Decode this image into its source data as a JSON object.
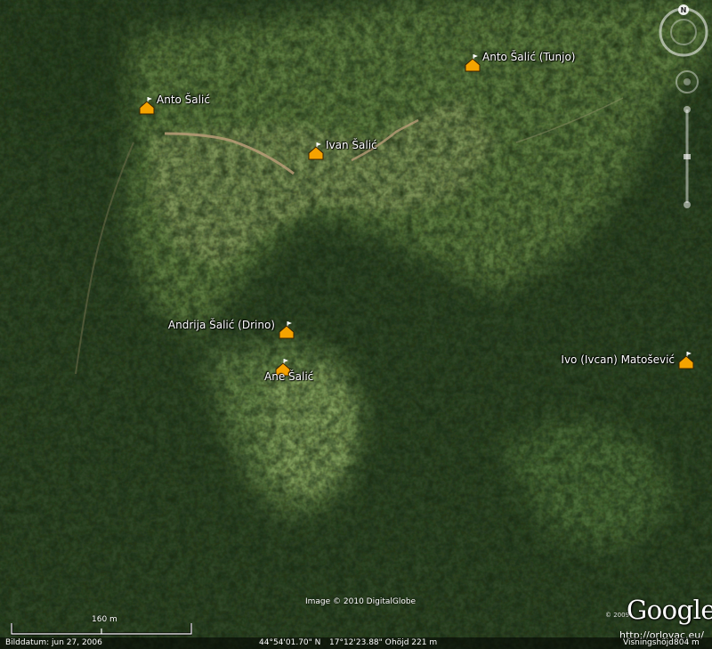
{
  "placemarks": [
    {
      "id": "anto-salic",
      "label": "Anto Šalić"
    },
    {
      "id": "anto-salic-tunjo",
      "label": "Anto Šalić (Tunjo)"
    },
    {
      "id": "ivan-salic",
      "label": "Ivan Šalić"
    },
    {
      "id": "andrija-salic-drino",
      "label": "Andrija Šalić (Drino)"
    },
    {
      "id": "ane-salic",
      "label": "Ane Šalić"
    },
    {
      "id": "ivo-ivcan-matosevic",
      "label": "Ivo (Ivcan) Matošević"
    }
  ],
  "imagery_credit": "Image © 2010 DigitalGlobe",
  "copyright_year": "© 2009",
  "brand": "Google",
  "site_url": "http://orlovac.eu/",
  "compass_north": "N",
  "scale_label": "160 m",
  "status": {
    "imagery_date": "Bilddatum: jun 27, 2006",
    "latitude": "44°54'01.70\" N",
    "longitude": "17°12'23.88\" O",
    "elevation": "höjd  221 m",
    "eye_alt_label": "Visningshöjd",
    "eye_alt_value": "804 m"
  },
  "colors": {
    "placemark_fill": "#f5a300",
    "label_text": "#ffffff"
  }
}
